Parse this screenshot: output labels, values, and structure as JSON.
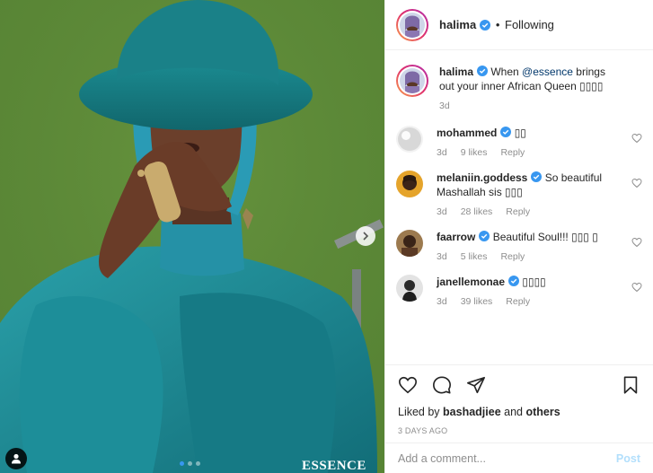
{
  "photo": {
    "watermark": "ESSENCE",
    "carousel_total": 3,
    "carousel_active": 1
  },
  "header": {
    "username": "halima",
    "separator": "•",
    "follow_label": "Following"
  },
  "caption": {
    "username": "halima",
    "text_before": "When ",
    "mention": "@essence",
    "text_after": " brings out your inner African Queen ▯▯▯▯",
    "time": "3d"
  },
  "comments": [
    {
      "username": "mohammed",
      "verified": true,
      "text": "▯▯",
      "time": "3d",
      "likes": "9 likes",
      "reply": "Reply"
    },
    {
      "username": "melaniin.goddess",
      "verified": true,
      "text": "So beautiful Mashallah sis ▯▯▯",
      "time": "3d",
      "likes": "28 likes",
      "reply": "Reply"
    },
    {
      "username": "faarrow",
      "verified": true,
      "text": "Beautiful Soul!!! ▯▯▯ ▯",
      "time": "3d",
      "likes": "5 likes",
      "reply": "Reply"
    },
    {
      "username": "janellemonae",
      "verified": true,
      "text": "▯▯▯▯",
      "time": "3d",
      "likes": "39 likes",
      "reply": "Reply"
    }
  ],
  "actions": {
    "liked_prefix": "Liked by ",
    "liked_user": "bashadjiee",
    "liked_suffix": " and ",
    "liked_others": "others",
    "date": "3 DAYS AGO"
  },
  "add_comment": {
    "placeholder": "Add a comment...",
    "post_label": "Post"
  },
  "icons": {
    "like": "heart-icon",
    "comment": "comment-icon",
    "share": "paper-plane-icon",
    "save": "bookmark-icon",
    "verified": "verified-badge-icon",
    "next": "chevron-right-icon",
    "tags": "user-tag-icon"
  },
  "colors": {
    "background": "#5f8a3a",
    "jacket": "#1f8a96",
    "hat": "#1c7f86",
    "verified": "#3897f0",
    "post_disabled": "#b2dffc",
    "mention": "#00376b"
  }
}
